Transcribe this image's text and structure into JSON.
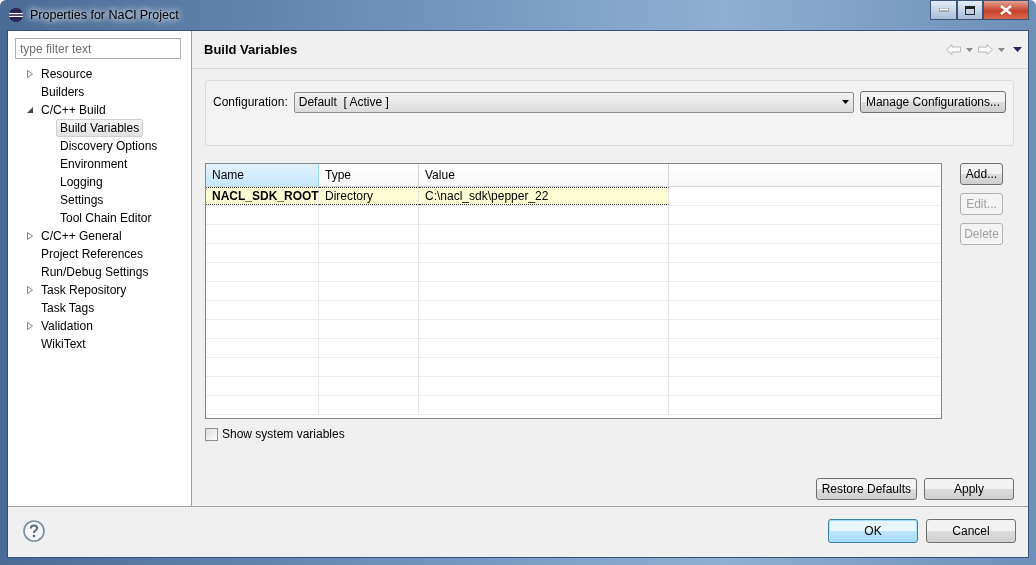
{
  "window": {
    "title": "Properties for NaCl Project"
  },
  "filter": {
    "placeholder": "type filter text"
  },
  "tree": [
    {
      "label": "Resource",
      "expanded": false,
      "selected": false
    },
    {
      "label": "Builders",
      "selected": false
    },
    {
      "label": "C/C++ Build",
      "expanded": true,
      "selected": false,
      "children": [
        {
          "label": "Build Variables",
          "selected": true
        },
        {
          "label": "Discovery Options",
          "selected": false
        },
        {
          "label": "Environment",
          "selected": false
        },
        {
          "label": "Logging",
          "selected": false
        },
        {
          "label": "Settings",
          "selected": false
        },
        {
          "label": "Tool Chain Editor",
          "selected": false
        }
      ]
    },
    {
      "label": "C/C++ General",
      "expanded": false,
      "selected": false
    },
    {
      "label": "Project References",
      "selected": false
    },
    {
      "label": "Run/Debug Settings",
      "selected": false
    },
    {
      "label": "Task Repository",
      "expanded": false,
      "selected": false
    },
    {
      "label": "Task Tags",
      "selected": false
    },
    {
      "label": "Validation",
      "expanded": false,
      "selected": false
    },
    {
      "label": "WikiText",
      "selected": false
    }
  ],
  "page": {
    "title": "Build Variables"
  },
  "configuration": {
    "label": "Configuration:",
    "value": "Default  [ Active ]",
    "button": "Manage Configurations..."
  },
  "table": {
    "columns": [
      {
        "label": "Name",
        "sorted": true
      },
      {
        "label": "Type",
        "sorted": false
      },
      {
        "label": "Value",
        "sorted": false
      }
    ],
    "rows": [
      {
        "cells": [
          "NACL_SDK_ROOT",
          "Directory",
          "C:\\nacl_sdk\\pepper_22"
        ],
        "selected": true
      }
    ]
  },
  "side_buttons": [
    {
      "label": "Add...",
      "disabled": false
    },
    {
      "label": "Edit...",
      "disabled": true
    },
    {
      "label": "Delete",
      "disabled": true
    }
  ],
  "show_system_variables": {
    "label": "Show system variables",
    "checked": false
  },
  "page_buttons": [
    {
      "label": "Restore Defaults"
    },
    {
      "label": "Apply"
    }
  ],
  "dialog_buttons": [
    {
      "label": "OK",
      "default": true
    },
    {
      "label": "Cancel",
      "default": false
    }
  ]
}
